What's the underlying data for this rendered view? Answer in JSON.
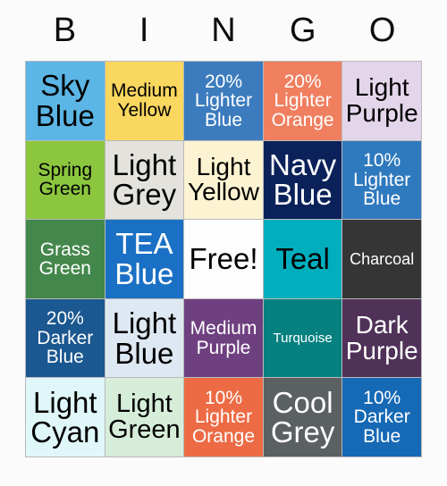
{
  "header": {
    "letters": [
      "B",
      "I",
      "N",
      "G",
      "O"
    ]
  },
  "card": {
    "free_space_text": "Free!",
    "border_color": "#b9b9b9",
    "background_color": "#fbfbfb",
    "header_text_color": "#0d0d0d"
  },
  "grid": {
    "columns": 5,
    "rows": 5,
    "cells": [
      {
        "label": "Sky Blue",
        "bg": "#5bb5e5",
        "fg": "#000000",
        "size": "xl"
      },
      {
        "label": "Medium Yellow",
        "bg": "#fad75f",
        "fg": "#000000",
        "size": "md"
      },
      {
        "label": "20% Lighter Blue",
        "bg": "#3c7cbe",
        "fg": "#ffffff",
        "size": "md"
      },
      {
        "label": "20% Lighter Orange",
        "bg": "#f07f5f",
        "fg": "#ffffff",
        "size": "md"
      },
      {
        "label": "Light Purple",
        "bg": "#e4d6ea",
        "fg": "#000000",
        "size": "lg"
      },
      {
        "label": "Spring Green",
        "bg": "#8cc63e",
        "fg": "#000000",
        "size": "md"
      },
      {
        "label": "Light Grey",
        "bg": "#e4e2dd",
        "fg": "#000000",
        "size": "xl"
      },
      {
        "label": "Light Yellow",
        "bg": "#fbf3d2",
        "fg": "#000000",
        "size": "lg"
      },
      {
        "label": "Navy Blue",
        "bg": "#0b2159",
        "fg": "#ffffff",
        "size": "xl"
      },
      {
        "label": "10% Lighter Blue",
        "bg": "#2f79be",
        "fg": "#ffffff",
        "size": "md"
      },
      {
        "label": "Grass Green",
        "bg": "#44874c",
        "fg": "#ffffff",
        "size": "md"
      },
      {
        "label": "TEA Blue",
        "bg": "#1a70c4",
        "fg": "#ffffff",
        "size": "xl"
      },
      {
        "label": "Free!",
        "bg": "#fdfdfd",
        "fg": "#000000",
        "size": "xl"
      },
      {
        "label": "Teal",
        "bg": "#00aebe",
        "fg": "#000000",
        "size": "xl"
      },
      {
        "label": "Charcoal",
        "bg": "#353535",
        "fg": "#ffffff",
        "size": "sm"
      },
      {
        "label": "20% Darker Blue",
        "bg": "#1b5790",
        "fg": "#ffffff",
        "size": "md"
      },
      {
        "label": "Light Blue",
        "bg": "#dde8f2",
        "fg": "#000000",
        "size": "xl"
      },
      {
        "label": "Medium Purple",
        "bg": "#6e4080",
        "fg": "#ffffff",
        "size": "md"
      },
      {
        "label": "Turquoise",
        "bg": "#078080",
        "fg": "#ffffff",
        "size": "xs"
      },
      {
        "label": "Dark Purple",
        "bg": "#503259",
        "fg": "#ffffff",
        "size": "lg"
      },
      {
        "label": "Light Cyan",
        "bg": "#e0f7f9",
        "fg": "#000000",
        "size": "xl"
      },
      {
        "label": "Light Green",
        "bg": "#d6edda",
        "fg": "#000000",
        "size": "lg"
      },
      {
        "label": "10% Lighter Orange",
        "bg": "#ec6b45",
        "fg": "#ffffff",
        "size": "md"
      },
      {
        "label": "Cool Grey",
        "bg": "#5b6063",
        "fg": "#ffffff",
        "size": "xl"
      },
      {
        "label": "10% Darker Blue",
        "bg": "#1669b5",
        "fg": "#ffffff",
        "size": "md"
      }
    ]
  }
}
